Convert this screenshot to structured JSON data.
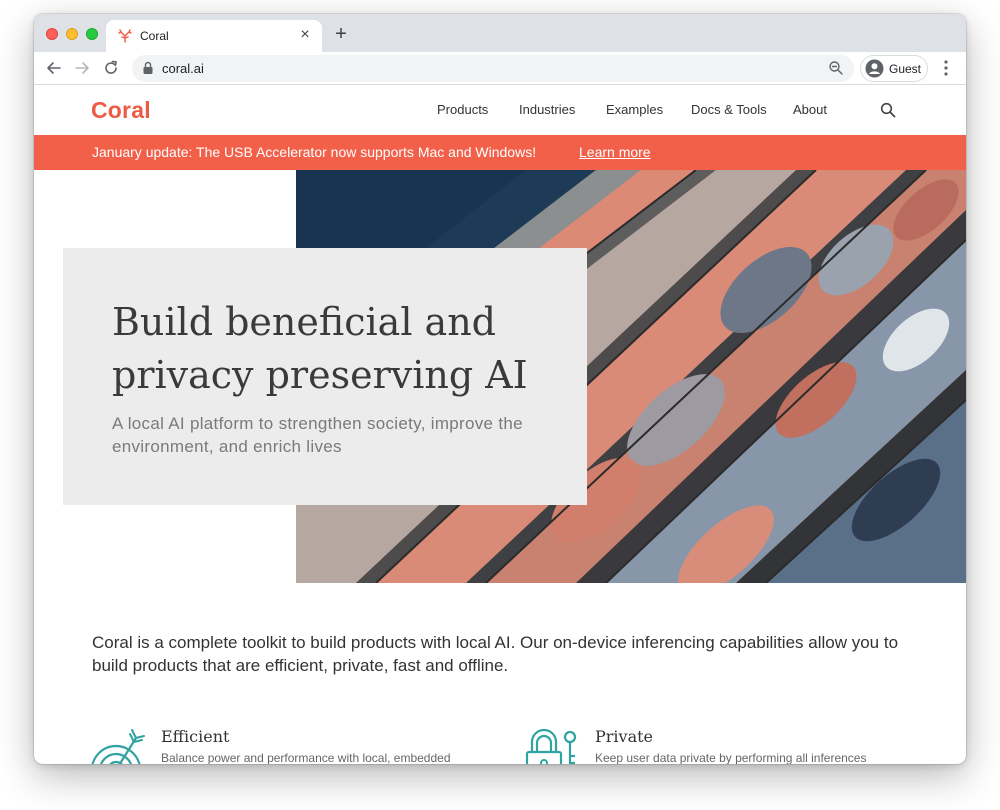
{
  "browser": {
    "tab_title": "Coral",
    "new_tab_label": "+",
    "close_label": "×",
    "url": "coral.ai",
    "profile_label": "Guest"
  },
  "site": {
    "logo": "Coral",
    "nav": [
      "Products",
      "Industries",
      "Examples",
      "Docs & Tools",
      "About"
    ]
  },
  "banner": {
    "text": "January update: The USB Accelerator now supports Mac and Windows!",
    "link": "Learn more"
  },
  "hero": {
    "title": "Build beneficial and\nprivacy preserving AI",
    "subtitle": "A local AI platform to strengthen society, improve the environment, and enrich lives"
  },
  "intro": "Coral is a complete toolkit to build products with local AI. Our on-device inferencing capabilities allow you to build products that are efficient, private, fast and offline.",
  "features": [
    {
      "title": "Efficient",
      "description": "Balance power and performance with local, embedded",
      "icon": "target-icon"
    },
    {
      "title": "Private",
      "description": "Keep user data private by performing all inferences",
      "icon": "lock-icon"
    }
  ],
  "colors": {
    "brand": "#ee5a44",
    "banner": "#f2604a",
    "accent_icons": "#2fa3a0"
  }
}
